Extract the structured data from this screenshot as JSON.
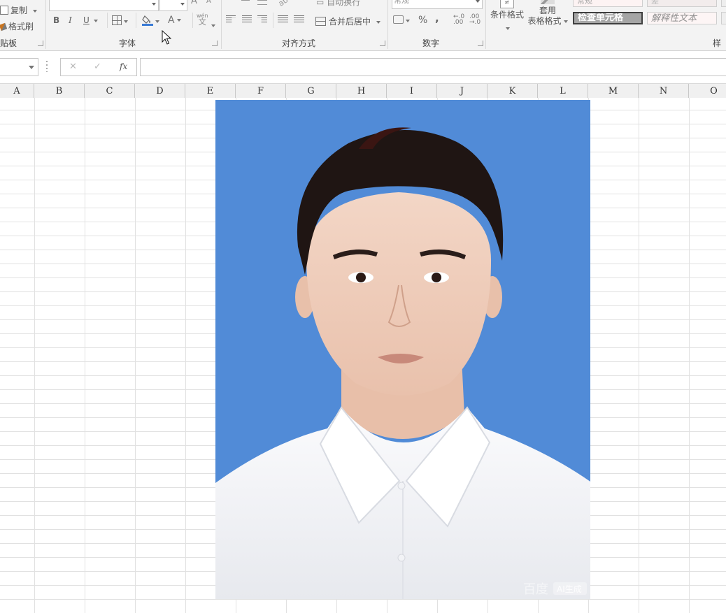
{
  "ribbon": {
    "clipboard": {
      "copy_label": "复制",
      "format_painter_label": "格式刷",
      "group_label": "贴板"
    },
    "font": {
      "bold_label": "B",
      "italic_label": "I",
      "underline_label": "U",
      "font_color_glyph": "A",
      "phonetic_top": "wén",
      "phonetic_bottom": "文",
      "group_label": "字体"
    },
    "alignment": {
      "merge_center_label": "合并后居中",
      "group_label": "对齐方式"
    },
    "number": {
      "percent_label": "%",
      "comma_label": ",",
      "group_label": "数字"
    },
    "styles": {
      "conditional_format_label": "条件格式",
      "table_format_line1": "套用",
      "table_format_line2": "表格格式",
      "check_cell_label": "检查单元格",
      "explanatory_text_label": "解释性文本",
      "group_label": "样式"
    }
  },
  "formula_bar": {
    "cancel_glyph": "✕",
    "enter_glyph": "✓",
    "fx_label": "fx"
  },
  "columns": [
    "A",
    "B",
    "C",
    "D",
    "E",
    "F",
    "G",
    "H",
    "I",
    "J",
    "K",
    "L",
    "M",
    "N",
    "O"
  ],
  "photo": {
    "background_color": "#518bd7",
    "watermark": "百度 AI生成"
  }
}
